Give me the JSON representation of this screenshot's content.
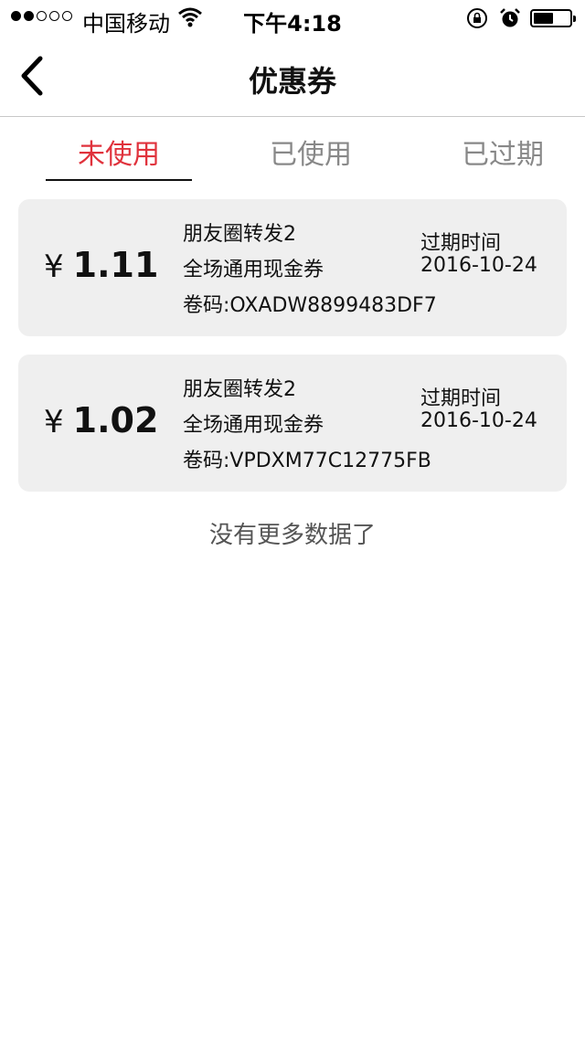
{
  "status_bar": {
    "carrier": "中国移动",
    "time": "下午4:18"
  },
  "header": {
    "title": "优惠券"
  },
  "tabs": [
    {
      "label": "未使用",
      "active": true
    },
    {
      "label": "已使用",
      "active": false
    },
    {
      "label": "已过期",
      "active": false
    }
  ],
  "coupons": [
    {
      "currency": "¥",
      "amount": "1.11",
      "name": "朋友圈转发2",
      "type": "全场通用现金券",
      "code": "卷码:OXADW8899483DF7",
      "expire_label": "过期时间",
      "expire_date": "2016-10-24"
    },
    {
      "currency": "¥",
      "amount": "1.02",
      "name": "朋友圈转发2",
      "type": "全场通用现金券",
      "code": "卷码:VPDXM77C12775FB",
      "expire_label": "过期时间",
      "expire_date": "2016-10-24"
    }
  ],
  "footer_text": "没有更多数据了",
  "colors": {
    "accent": "#e0323c",
    "card_bg": "#efefef",
    "inactive_tab": "#888888"
  },
  "icons": {
    "back": "chevron-left-icon",
    "wifi": "wifi-icon",
    "lock": "rotation-lock-icon",
    "alarm": "alarm-icon",
    "battery": "battery-icon"
  }
}
